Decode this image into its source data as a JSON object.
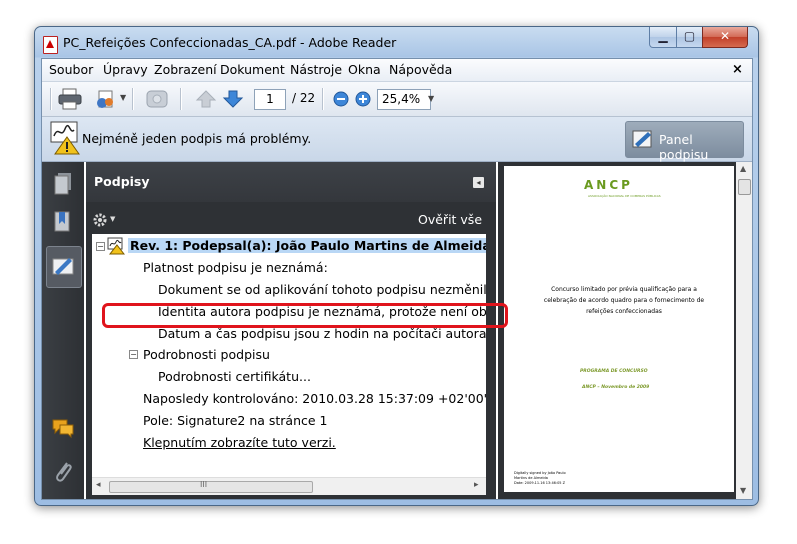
{
  "window": {
    "title": "PC_Refeições Confeccionadas_CA.pdf - Adobe Reader",
    "min_label": "▁",
    "max_label": "▢",
    "close_label": "✕"
  },
  "menu": [
    "Soubor",
    "Úpravy",
    "Zobrazení",
    "Dokument",
    "Nástroje",
    "Okna",
    "Nápověda"
  ],
  "menu_close": "×",
  "toolbar": {
    "page_current": "1",
    "page_total": "/ 22",
    "zoom": "25,4%"
  },
  "notice": {
    "text": "Nejméně jeden podpis má problémy.",
    "panel_button": "Panel podpisu"
  },
  "signatures_panel": {
    "title": "Podpisy",
    "verify_all": "Ověřit vše",
    "tree": [
      "Rev. 1: Podepsal(a): João Paulo Martins de Almeida",
      "Platnost podpisu je neznámá:",
      "Dokument se od aplikování tohoto podpisu nezměnil",
      "Identita autora podpisu je neznámá, protože není obsažena ve",
      "Datum a čas podpisu jsou z hodin na počítači autora podpisu.",
      "Podrobnosti podpisu",
      "Podrobnosti certifikátu...",
      "Naposledy kontrolováno: 2010.03.28 15:37:09 +02'00'",
      "Pole: Signature2 na stránce 1",
      "Klepnutím zobrazíte tuto verzi."
    ],
    "scroll_grip": "III"
  },
  "document_page": {
    "logo": "ANCP",
    "logo_sub": "ASSOCIAÇÃO NACIONAL DE COMPRAS PÚBLICAS",
    "body": "Concurso limitado por prévia qualificação para a celebração de acordo quadro para o fornecimento de refeições confeccionadas",
    "program": "PROGRAMA DE CONCURSO",
    "date": "ANCP – Novembro de 2009",
    "sig_line1": "Digitally signed by João Paulo",
    "sig_line2": "Martins de Almeida",
    "sig_line3": "Date: 2009.11.16 13:46:05 Z"
  },
  "colors": {
    "highlight": "#e0141c",
    "panel_bg": "#2e3135",
    "accent_green": "#6a9a1f"
  }
}
